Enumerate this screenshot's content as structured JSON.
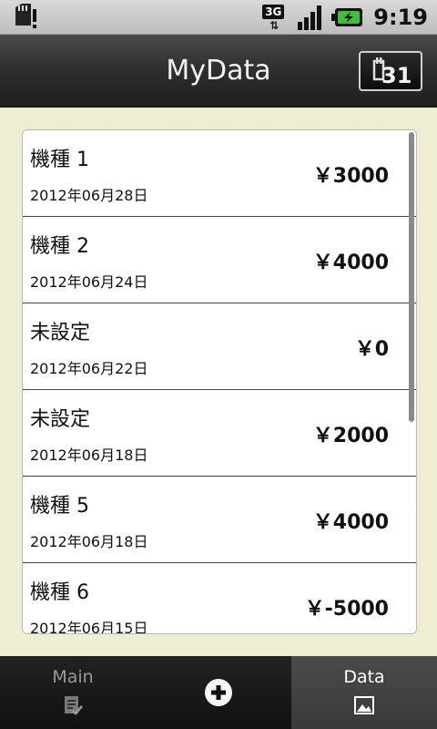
{
  "status_bar": {
    "network": "3G",
    "time": "9:19"
  },
  "header": {
    "title": "MyData",
    "calendar_button_label": "31"
  },
  "list": {
    "items": [
      {
        "name": "機種 1",
        "date": "2012年06月28日",
        "amount": "￥3000"
      },
      {
        "name": "機種 2",
        "date": "2012年06月24日",
        "amount": "￥4000"
      },
      {
        "name": "未設定",
        "date": "2012年06月22日",
        "amount": "￥0"
      },
      {
        "name": "未設定",
        "date": "2012年06月18日",
        "amount": "￥2000"
      },
      {
        "name": "機種 5",
        "date": "2012年06月18日",
        "amount": "￥4000"
      },
      {
        "name": "機種 6",
        "date": "2012年06月15日",
        "amount": "￥-5000"
      }
    ]
  },
  "tabs": {
    "main_label": "Main",
    "data_label": "Data"
  },
  "colors": {
    "content_bg": "#efeed2",
    "header_bg": "#2e2e2e",
    "tab_selected_bg": "#444444"
  }
}
